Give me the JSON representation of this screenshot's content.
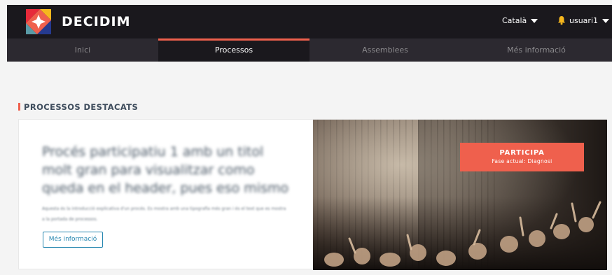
{
  "header": {
    "brand": "DECIDIM",
    "language": "Català",
    "username": "usuari1"
  },
  "nav": {
    "items": [
      {
        "label": "Inici"
      },
      {
        "label": "Processos"
      },
      {
        "label": "Assemblees"
      },
      {
        "label": "Més informació"
      }
    ]
  },
  "highlighted": {
    "section_title": "PROCESSOS DESTACATS",
    "process_title": "Procés participatiu 1 amb un titol molt gran para visualitzar como queda en el header, pues eso mismo",
    "process_description": "Aquesta és la introducció explicativa d'un procés. Es mostra amb una tipografia més gran i és el text que es mostra a la portada de processos.",
    "more_info_label": "Més informació",
    "participate_label": "PARTICIPA",
    "current_phase": "Fase actual: Diagnosi"
  },
  "colors": {
    "accent": "#ef604d",
    "topbar": "#1a181d",
    "navbar": "#2c2930",
    "link": "#2787b0"
  }
}
